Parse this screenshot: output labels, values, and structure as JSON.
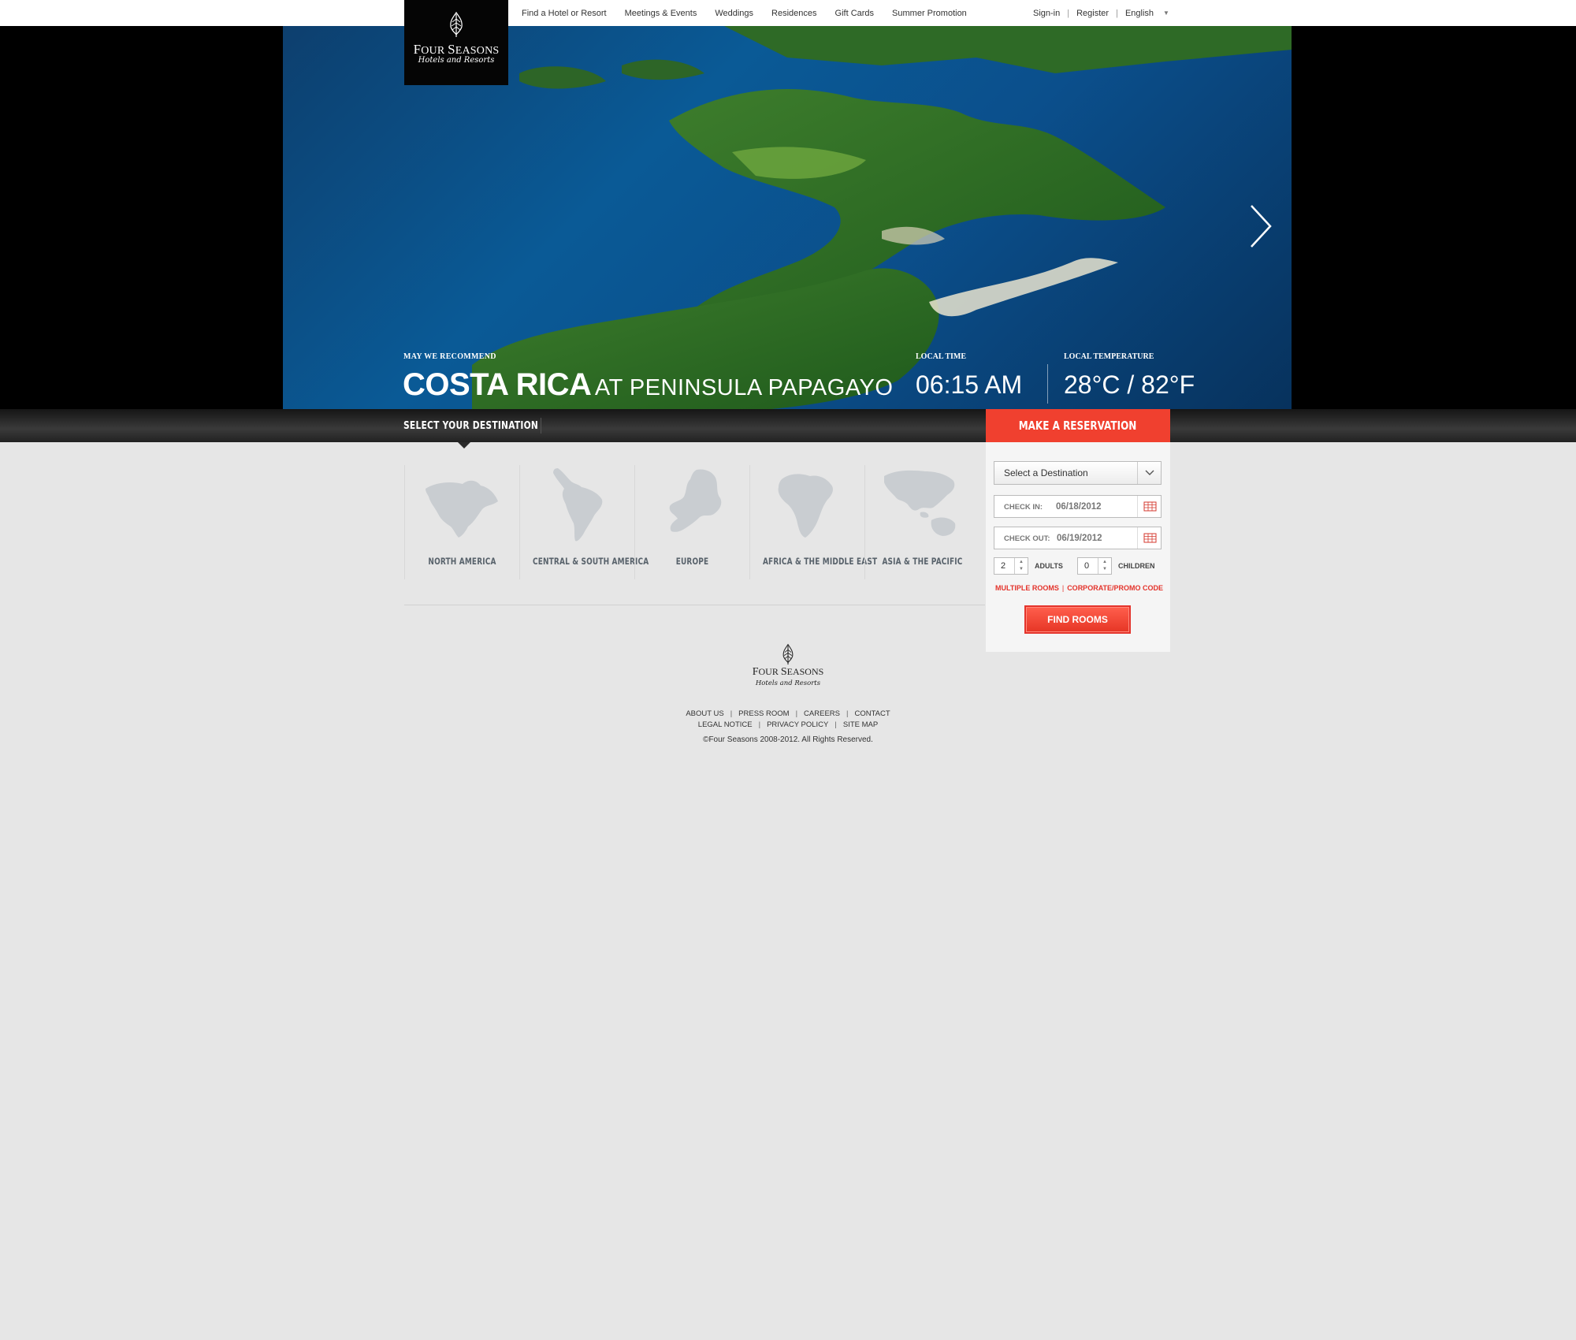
{
  "nav": {
    "items": [
      "Find a Hotel or Resort",
      "Meetings & Events",
      "Weddings",
      "Residences",
      "Gift Cards",
      "Summer Promotion"
    ]
  },
  "utility": {
    "signin": "Sign-in",
    "register": "Register",
    "language": "English"
  },
  "logo": {
    "brand_first": "F",
    "brand_rest": "OUR ",
    "brand_second": "S",
    "brand_rest2": "EASONS",
    "sub": "Hotels and Resorts"
  },
  "hero": {
    "recommend_label": "MAY WE RECOMMEND",
    "title_big": "COSTA RICA",
    "title_small": "AT PENINSULA PAPAGAYO",
    "time_label": "LOCAL TIME",
    "time_value": "06:15 AM",
    "temp_label": "LOCAL TEMPERATURE",
    "temp_value": "28°C / 82°F"
  },
  "destinations": {
    "label": "SELECT YOUR DESTINATION",
    "regions": [
      "NORTH AMERICA",
      "CENTRAL & SOUTH AMERICA",
      "EUROPE",
      "AFRICA & THE MIDDLE EAST",
      "ASIA & THE PACIFIC"
    ]
  },
  "reservation": {
    "title": "MAKE A RESERVATION",
    "destination_select": "Select a Destination",
    "checkin_label": "CHECK IN:",
    "checkin_value": "06/18/2012",
    "checkout_label": "CHECK OUT:",
    "checkout_value": "06/19/2012",
    "adults_value": "2",
    "adults_label": "ADULTS",
    "children_value": "0",
    "children_label": "CHILDREN",
    "multiple_rooms": "MULTIPLE ROOMS",
    "promo_code": "CORPORATE/PROMO CODE",
    "find_button": "FIND ROOMS"
  },
  "footer": {
    "row1": [
      "ABOUT US",
      "PRESS ROOM",
      "CAREERS",
      "CONTACT"
    ],
    "row2": [
      "LEGAL NOTICE",
      "PRIVACY POLICY",
      "SITE MAP"
    ],
    "copyright": "©Four Seasons 2008-2012. All Rights Reserved."
  },
  "colors": {
    "accent_red": "#f0402f",
    "page_bg": "#e6e6e6",
    "region_text": "#58626b"
  }
}
